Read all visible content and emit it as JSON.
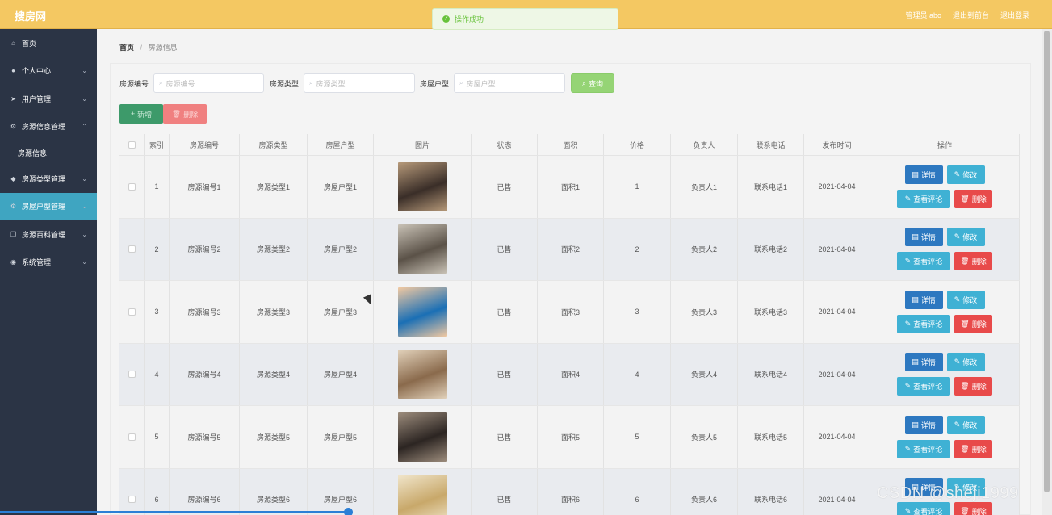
{
  "header": {
    "brand": "搜房网",
    "links": [
      "管理员 abo",
      "退出到前台",
      "退出登录"
    ],
    "toast": "操作成功"
  },
  "sidebar": {
    "items": [
      {
        "label": "首页",
        "icon": "home-icon",
        "arrow": ""
      },
      {
        "label": "个人中心",
        "icon": "user-icon",
        "arrow": "⌄"
      },
      {
        "label": "用户管理",
        "icon": "send-icon",
        "arrow": "⌄"
      },
      {
        "label": "房源信息管理",
        "icon": "gear-icon",
        "arrow": "⌃"
      },
      {
        "label": "房源信息",
        "icon": "",
        "arrow": "",
        "sub": true
      },
      {
        "label": "房源类型管理",
        "icon": "location-icon",
        "arrow": "⌄"
      },
      {
        "label": "房屋户型管理",
        "icon": "gear-icon",
        "arrow": "⌄",
        "active": true
      },
      {
        "label": "房源百科管理",
        "icon": "copy-icon",
        "arrow": "⌄"
      },
      {
        "label": "系统管理",
        "icon": "mic-icon",
        "arrow": "⌄"
      }
    ]
  },
  "breadcrumb": {
    "home": "首页",
    "current": "房源信息"
  },
  "search": {
    "fields": [
      {
        "label": "房源编号",
        "placeholder": "房源编号"
      },
      {
        "label": "房源类型",
        "placeholder": "房源类型"
      },
      {
        "label": "房屋户型",
        "placeholder": "房屋户型"
      }
    ],
    "query_label": "查询"
  },
  "actions": {
    "add_label": "新增",
    "delete_label": "删除"
  },
  "table": {
    "headers": [
      "索引",
      "房源编号",
      "房源类型",
      "房屋户型",
      "图片",
      "状态",
      "面积",
      "价格",
      "负责人",
      "联系电话",
      "发布时间",
      "操作"
    ],
    "rows": [
      {
        "index": "1",
        "code": "房源编号1",
        "type": "房源类型1",
        "layout": "房屋户型1",
        "status": "已售",
        "area": "面积1",
        "price": "1",
        "owner": "负责人1",
        "phone": "联系电话1",
        "date": "2021-04-04",
        "thumb": [
          "#3a2e28",
          "#b79a7a"
        ]
      },
      {
        "index": "2",
        "code": "房源编号2",
        "type": "房源类型2",
        "layout": "房屋户型2",
        "status": "已售",
        "area": "面积2",
        "price": "2",
        "owner": "负责人2",
        "phone": "联系电话2",
        "date": "2021-04-04",
        "thumb": [
          "#5b5248",
          "#c9c2b6"
        ]
      },
      {
        "index": "3",
        "code": "房源编号3",
        "type": "房源类型3",
        "layout": "房屋户型3",
        "status": "已售",
        "area": "面积3",
        "price": "3",
        "owner": "负责人3",
        "phone": "联系电话3",
        "date": "2021-04-04",
        "thumb": [
          "#1a6fb5",
          "#f2c9a1"
        ]
      },
      {
        "index": "4",
        "code": "房源编号4",
        "type": "房源类型4",
        "layout": "房屋户型4",
        "status": "已售",
        "area": "面积4",
        "price": "4",
        "owner": "负责人4",
        "phone": "联系电话4",
        "date": "2021-04-04",
        "thumb": [
          "#8a6a4c",
          "#e2d2bb"
        ]
      },
      {
        "index": "5",
        "code": "房源编号5",
        "type": "房源类型5",
        "layout": "房屋户型5",
        "status": "已售",
        "area": "面积5",
        "price": "5",
        "owner": "负责人5",
        "phone": "联系电话5",
        "date": "2021-04-04",
        "thumb": [
          "#2c2522",
          "#9c8c7c"
        ]
      },
      {
        "index": "6",
        "code": "房源编号6",
        "type": "房源类型6",
        "layout": "房屋户型6",
        "status": "已售",
        "area": "面积6",
        "price": "6",
        "owner": "负责人6",
        "phone": "联系电话6",
        "date": "2021-04-04",
        "thumb": [
          "#c8a86a",
          "#f1e6cc"
        ]
      }
    ],
    "row_actions": {
      "detail": "详情",
      "edit": "修改",
      "review": "查看评论",
      "delete": "删除"
    }
  },
  "watermark": "CSDN @sheji1999"
}
